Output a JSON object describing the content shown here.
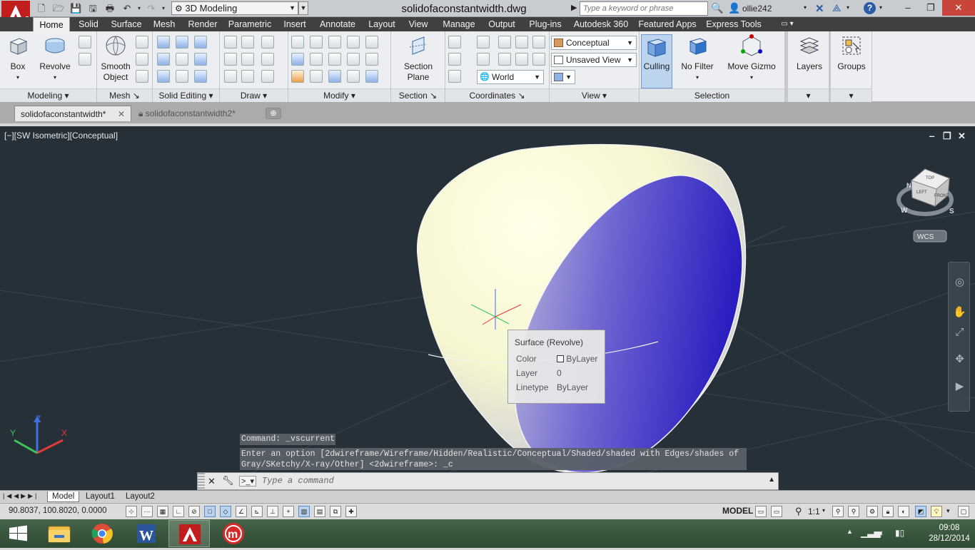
{
  "title_bar": {
    "workspace": "3D Modeling",
    "document_title": "solidofaconstantwidth.dwg",
    "search_placeholder": "Type a keyword or phrase",
    "username": "ollie242",
    "window_controls": [
      "minimize-icon",
      "restore-icon",
      "close-icon"
    ]
  },
  "menu_tabs": [
    "Home",
    "Solid",
    "Surface",
    "Mesh",
    "Render",
    "Parametric",
    "Insert",
    "Annotate",
    "Layout",
    "View",
    "Manage",
    "Output",
    "Plug-ins",
    "Autodesk 360",
    "Featured Apps",
    "Express Tools"
  ],
  "active_menu_tab": "Home",
  "ribbon": {
    "modeling": {
      "box": "Box",
      "revolve": "Revolve",
      "label": "Modeling"
    },
    "mesh": {
      "smooth_line1": "Smooth",
      "smooth_line2": "Object",
      "label": "Mesh"
    },
    "solid_editing": {
      "label": "Solid Editing"
    },
    "draw": {
      "label": "Draw"
    },
    "modify": {
      "label": "Modify"
    },
    "section": {
      "line1": "Section",
      "line2": "Plane",
      "label": "Section"
    },
    "coordinates": {
      "world": "World",
      "label": "Coordinates"
    },
    "view": {
      "visual_style": "Conceptual",
      "named_view": "Unsaved View",
      "label": "View"
    },
    "selection": {
      "culling": "Culling",
      "no_filter": "No Filter",
      "move_gizmo": "Move Gizmo",
      "label": "Selection"
    },
    "layers": {
      "label": "Layers"
    },
    "groups": {
      "label": "Groups"
    }
  },
  "file_tabs": [
    {
      "label": "solidofaconstantwidth*",
      "active": true
    },
    {
      "label": "solidofaconstantwidth2*",
      "active": false
    }
  ],
  "viewport": {
    "label": "[−][SW Isometric][Conceptual]",
    "viewcube": {
      "top": "TOP",
      "left": "LEFT",
      "front": "FRONT",
      "compass": [
        "N",
        "W",
        "S"
      ],
      "wcs": "WCS"
    },
    "ucs": {
      "x": "X",
      "y": "Y",
      "z": "Z"
    },
    "colors": {
      "background": "#263039",
      "surface_light": "#fbfbdc",
      "surface_blue": "#3c32c8"
    }
  },
  "tooltip": {
    "title": "Surface (Revolve)",
    "rows": [
      {
        "key": "Color",
        "value": "ByLayer"
      },
      {
        "key": "Layer",
        "value": "0"
      },
      {
        "key": "Linetype",
        "value": "ByLayer"
      }
    ]
  },
  "command": {
    "history": "Command: _vscurrent",
    "prompt_line1": "Enter an option [2dwireframe/Wireframe/Hidden/Realistic/Conceptual/Shaded/shaded with Edges/shades of",
    "prompt_line2": "Gray/SKetchy/X-ray/Other] <2dwireframe>: _c",
    "placeholder": "Type a command"
  },
  "layout_tabs": [
    "Model",
    "Layout1",
    "Layout2"
  ],
  "active_layout": "Model",
  "status_bar": {
    "coordinates": "90.8037, 100.8020, 0.0000",
    "model": "MODEL",
    "scale": "1:1"
  },
  "taskbar": {
    "apps": [
      "windows-start-icon",
      "file-explorer-icon",
      "chrome-icon",
      "word-icon",
      "autocad-icon",
      "app-m-icon"
    ],
    "time": "09:08",
    "date": "28/12/2014"
  }
}
